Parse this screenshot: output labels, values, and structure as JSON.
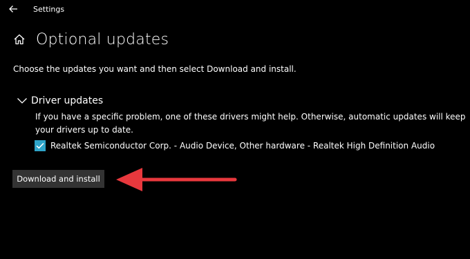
{
  "window": {
    "title": "Settings"
  },
  "page": {
    "title": "Optional updates",
    "intro": "Choose the updates you want and then select Download and install."
  },
  "driver_updates": {
    "header": "Driver updates",
    "expanded": true,
    "description": "If you have a specific problem, one of these drivers might help. Otherwise, automatic updates will keep your drivers up to date.",
    "items": [
      {
        "label": "Realtek Semiconductor Corp. - Audio Device, Other hardware - Realtek High Definition Audio",
        "checked": true
      }
    ]
  },
  "actions": {
    "download_label": "Download and install"
  },
  "icons": {
    "back": "back-arrow-icon",
    "home": "home-icon",
    "chevron": "chevron-down-icon",
    "check": "checkmark-icon",
    "annotation": "red-arrow-annotation"
  },
  "colors": {
    "background": "#000000",
    "accent": "#2ea4c9",
    "button": "#333333",
    "annotation": "#e8383d"
  }
}
